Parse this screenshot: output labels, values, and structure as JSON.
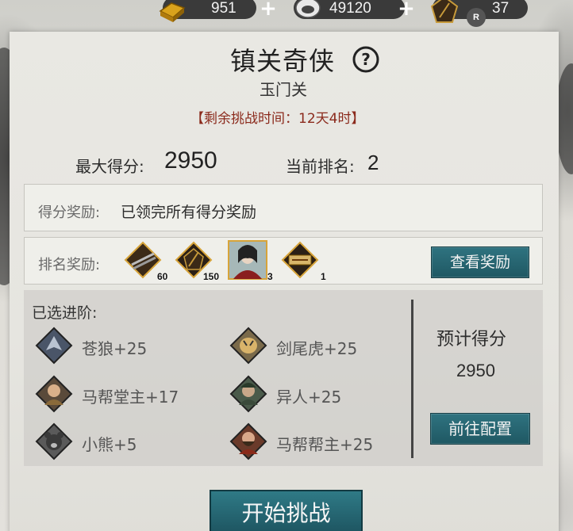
{
  "resources": [
    {
      "icon": "gold-bar-icon",
      "value": "951"
    },
    {
      "icon": "silver-icon",
      "value": "49120"
    },
    {
      "icon": "token-icon",
      "value": "37"
    }
  ],
  "badge": "R",
  "title": "镇关奇侠",
  "subtitle": "玉门关",
  "time_left": "【剩余挑战时间：12天4时】",
  "stats": {
    "max_score_label": "最大得分:",
    "max_score_value": "2950",
    "rank_label": "当前排名:",
    "rank_value": "2"
  },
  "score_reward": {
    "label": "得分奖励:",
    "text": "已领完所有得分奖励"
  },
  "rank_reward": {
    "label": "排名奖励:",
    "items": [
      {
        "icon": "arrows-icon",
        "count": "60"
      },
      {
        "icon": "token-icon",
        "count": "150"
      },
      {
        "icon": "hero-portrait-icon",
        "count": "3"
      },
      {
        "icon": "title-plaque-icon",
        "count": "1"
      }
    ],
    "button": "查看奖励"
  },
  "tiers": {
    "title": "已选进阶:",
    "items": [
      {
        "icon": "wolf-icon",
        "label": "苍狼+25"
      },
      {
        "icon": "tiger-icon",
        "label": "剑尾虎+25"
      },
      {
        "icon": "hall-master-icon",
        "label": "马帮堂主+17"
      },
      {
        "icon": "stranger-icon",
        "label": "异人+25"
      },
      {
        "icon": "bear-icon",
        "label": "小熊+5"
      },
      {
        "icon": "gang-leader-icon",
        "label": "马帮帮主+25"
      }
    ]
  },
  "expected": {
    "label": "预计得分",
    "value": "2950",
    "button": "前往配置"
  },
  "start_button": "开始挑战"
}
